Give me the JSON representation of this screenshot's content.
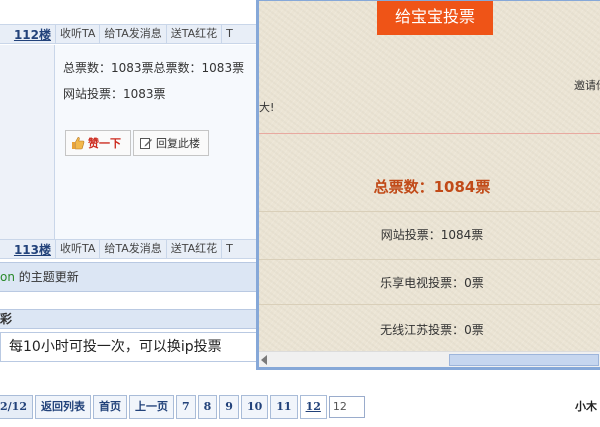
{
  "forum": {
    "floor_a": {
      "number": "112楼",
      "actions": [
        "收听TA",
        "给TA发消息",
        "送TA红花",
        "T"
      ]
    },
    "floor_b": {
      "number": "113楼",
      "actions": [
        "收听TA",
        "给TA发消息",
        "送TA红花",
        "T"
      ]
    },
    "post": {
      "line1": "总票数：1083票总票数：1083票",
      "line2": "网站投票：1083票",
      "like_label": "赞一下",
      "reply_label": "回复此楼"
    },
    "update_bar": {
      "nick": "on",
      "text": " 的主题更新"
    },
    "section_title": "彩",
    "reply_text": "每10小时可投一次，可以换ip投票"
  },
  "pager": {
    "current": "2/12",
    "back_to_list": "返回列表",
    "first": "首页",
    "prev": "上一页",
    "pages": [
      "7",
      "8",
      "9",
      "10",
      "11",
      "12"
    ],
    "selected_page": "12",
    "input_value": "12"
  },
  "author_tag": "小木",
  "popup": {
    "vote_button": "给宝宝投票",
    "invite_text": "邀请你",
    "clipped_text": "大!",
    "total_votes": "总票数：1084票",
    "site_votes": "网站投票：1084票",
    "letv_votes": "乐享电视投票：0票",
    "wuxi_votes": "无线江苏投票：0票"
  },
  "colors": {
    "accent_orange": "#ef5417",
    "total_votes_red": "#c14a18",
    "link_blue": "#22427a",
    "popup_border": "#86a8d8"
  }
}
